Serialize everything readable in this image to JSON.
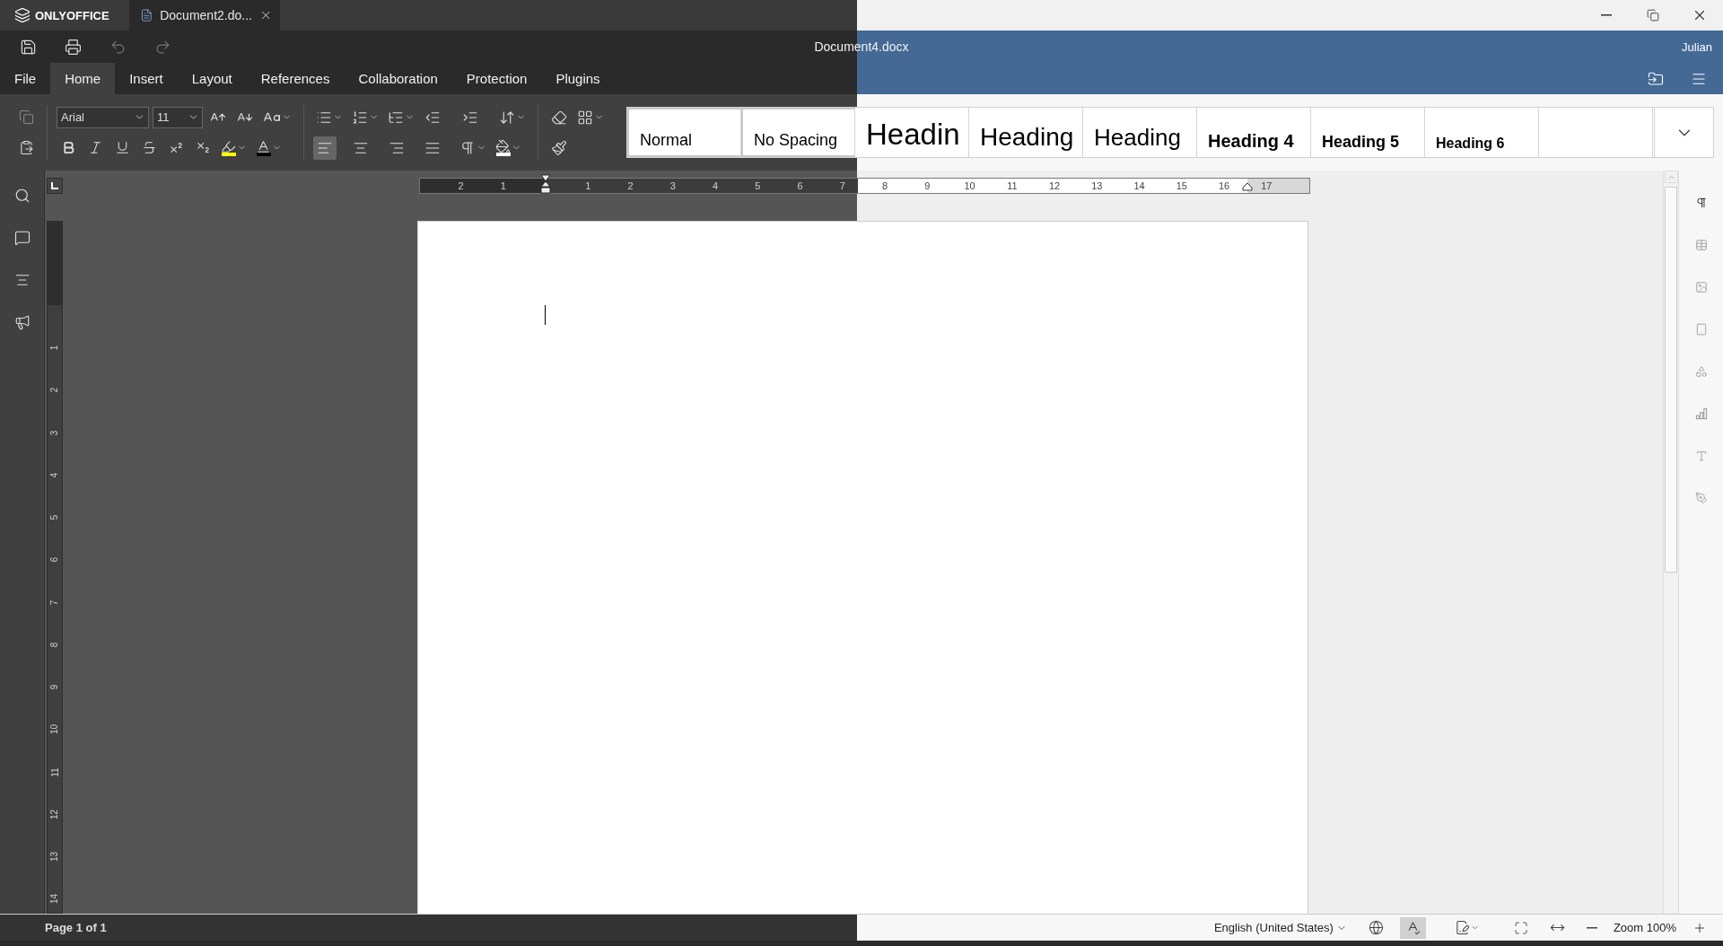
{
  "title_bar": {
    "app_name": "ONLYOFFICE",
    "tabs": [
      {
        "label": "Document2.do...",
        "selected": true
      }
    ]
  },
  "header": {
    "quick_access": [
      {
        "kind": "save",
        "disabled": false
      },
      {
        "kind": "print",
        "disabled": false
      },
      {
        "kind": "undo",
        "disabled": true
      },
      {
        "kind": "redo",
        "disabled": true
      }
    ],
    "document_title": "Document4.docx",
    "user": "Julian"
  },
  "menu_tabs": [
    {
      "label": "File",
      "selected": false
    },
    {
      "label": "Home",
      "selected": true
    },
    {
      "label": "Insert",
      "selected": false
    },
    {
      "label": "Layout",
      "selected": false
    },
    {
      "label": "References",
      "selected": false
    },
    {
      "label": "Collaboration",
      "selected": false
    },
    {
      "label": "Protection",
      "selected": false
    },
    {
      "label": "Plugins",
      "selected": false
    }
  ],
  "toolbar": {
    "font": "Arial",
    "font_size": "11",
    "alignment": [
      {
        "kind": "left",
        "selected": true
      },
      {
        "kind": "center",
        "selected": false
      },
      {
        "kind": "right",
        "selected": false
      },
      {
        "kind": "justify",
        "selected": false
      }
    ]
  },
  "styles": [
    {
      "label": "Normal",
      "kind": "normal"
    },
    {
      "label": "No Spacing",
      "kind": "no-spacing"
    },
    {
      "label": "Headin",
      "kind": "heading1"
    },
    {
      "label": "Heading",
      "kind": "heading2"
    },
    {
      "label": "Heading",
      "kind": "heading3"
    },
    {
      "label": "Heading 4",
      "kind": "heading4"
    },
    {
      "label": "Heading 5",
      "kind": "heading5"
    },
    {
      "label": "Heading 6",
      "kind": "heading6"
    },
    {
      "kind": "blank"
    }
  ],
  "ruler": [
    {
      "kind": "number",
      "label": "2"
    },
    {
      "kind": "number",
      "label": "1"
    },
    {
      "kind": "indent"
    },
    {
      "kind": "number",
      "label": "1"
    },
    {
      "kind": "number",
      "label": "2"
    },
    {
      "kind": "number",
      "label": "3"
    },
    {
      "kind": "number",
      "label": "4"
    },
    {
      "kind": "number",
      "label": "5"
    },
    {
      "kind": "number",
      "label": "6"
    },
    {
      "kind": "number",
      "label": "7"
    },
    {
      "kind": "number",
      "label": "8"
    },
    {
      "kind": "number",
      "label": "9"
    },
    {
      "kind": "number",
      "label": "10"
    },
    {
      "kind": "number",
      "label": "11"
    },
    {
      "kind": "number",
      "label": "12"
    },
    {
      "kind": "number",
      "label": "13"
    },
    {
      "kind": "number",
      "label": "14"
    },
    {
      "kind": "number",
      "label": "15"
    },
    {
      "kind": "number",
      "label": "16"
    },
    {
      "kind": "number",
      "label": "17"
    }
  ],
  "vertical_ruler": [
    "1",
    "2",
    "3",
    "4",
    "5",
    "6",
    "7",
    "8",
    "9",
    "10",
    "11",
    "12",
    "13",
    "14"
  ],
  "left_sidebar": [
    {
      "kind": "search"
    },
    {
      "kind": "comments"
    },
    {
      "kind": "navigation"
    },
    {
      "kind": "feedback"
    }
  ],
  "right_sidebar": [
    {
      "kind": "paragraph",
      "selected": true
    },
    {
      "kind": "table",
      "selected": false
    },
    {
      "kind": "image",
      "selected": false
    },
    {
      "kind": "header-footer",
      "selected": false
    },
    {
      "kind": "shape",
      "selected": false
    },
    {
      "kind": "chart",
      "selected": false
    },
    {
      "kind": "text-art",
      "selected": false
    },
    {
      "kind": "signature",
      "selected": false
    }
  ],
  "status_bar": {
    "page": "Page 1 of 1",
    "language": "English (United States)",
    "spell_check": true,
    "zoom": "Zoom 100%"
  }
}
